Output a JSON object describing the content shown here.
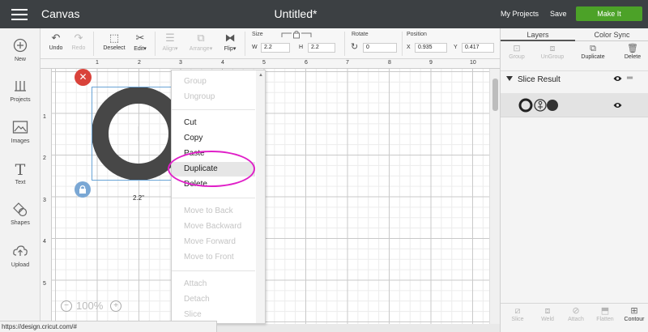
{
  "topbar": {
    "app_title": "Canvas",
    "doc_title": "Untitled*",
    "my_projects": "My Projects",
    "save": "Save",
    "make_it": "Make It"
  },
  "left_tools": [
    {
      "label": "New",
      "icon": "plus-circle-icon"
    },
    {
      "label": "Projects",
      "icon": "projects-icon"
    },
    {
      "label": "Images",
      "icon": "images-icon"
    },
    {
      "label": "Text",
      "icon": "text-icon"
    },
    {
      "label": "Shapes",
      "icon": "shapes-icon"
    },
    {
      "label": "Upload",
      "icon": "upload-icon"
    }
  ],
  "toolbar": {
    "undo": "Undo",
    "redo": "Redo",
    "deselect": "Deselect",
    "edit": "Edit",
    "align": "Align",
    "arrange": "Arrange",
    "flip": "Flip",
    "size_label": "Size",
    "w_label": "W",
    "w_value": "2.2",
    "h_label": "H",
    "h_value": "2.2",
    "rotate_label": "Rotate",
    "rotate_value": "0",
    "position_label": "Position",
    "x_label": "X",
    "x_value": "0.935",
    "y_label": "Y",
    "y_value": "0.417"
  },
  "canvas": {
    "ruler_top": [
      "1",
      "2",
      "3",
      "4",
      "5",
      "6",
      "7",
      "8",
      "9",
      "10"
    ],
    "ruler_left": [
      "1",
      "2",
      "3",
      "4",
      "5"
    ],
    "dimension_label": "2.2\"",
    "zoom": "100%",
    "ring_color": "#474747"
  },
  "context_menu": {
    "items": [
      {
        "label": "Group",
        "enabled": false
      },
      {
        "label": "Ungroup",
        "enabled": false
      },
      {
        "label": "Cut",
        "enabled": true
      },
      {
        "label": "Copy",
        "enabled": true
      },
      {
        "label": "Paste",
        "enabled": true
      },
      {
        "label": "Duplicate",
        "enabled": true
      },
      {
        "label": "Delete",
        "enabled": true
      },
      {
        "label": "Move to Back",
        "enabled": false
      },
      {
        "label": "Move Backward",
        "enabled": false
      },
      {
        "label": "Move Forward",
        "enabled": false
      },
      {
        "label": "Move to Front",
        "enabled": false
      },
      {
        "label": "Attach",
        "enabled": false
      },
      {
        "label": "Detach",
        "enabled": false
      },
      {
        "label": "Slice",
        "enabled": false
      }
    ],
    "highlight_color": "#e020c8"
  },
  "right_panel": {
    "tabs": [
      "Layers",
      "Color Sync"
    ],
    "buttons": [
      {
        "label": "Group",
        "enabled": false
      },
      {
        "label": "UnGroup",
        "enabled": false
      },
      {
        "label": "Duplicate",
        "enabled": true
      },
      {
        "label": "Delete",
        "enabled": true
      }
    ],
    "layer_group": "Slice Result",
    "bottom_buttons": [
      {
        "label": "Slice",
        "enabled": false
      },
      {
        "label": "Weld",
        "enabled": false
      },
      {
        "label": "Attach",
        "enabled": false
      },
      {
        "label": "Flatten",
        "enabled": false
      },
      {
        "label": "Contour",
        "enabled": true
      }
    ]
  },
  "statusbar": {
    "url": "https://design.cricut.com/#"
  },
  "colors": {
    "topbar": "#3c4043",
    "make_it": "#4ca228",
    "delete_handle": "#d9423a",
    "selection": "#6aa4d6"
  }
}
